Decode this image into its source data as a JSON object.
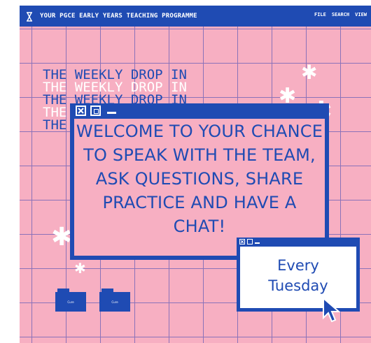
{
  "header": {
    "title": "YOUR PGCE EARLY YEARS TEACHING PROGRAMME",
    "menu": [
      "FILE",
      "SEARCH",
      "VIEW"
    ]
  },
  "echo_title": "THE WEEKLY DROP IN",
  "main_window": {
    "lines": [
      "WELCOME TO YOUR CHANCE",
      "TO SPEAK WITH THE TEAM,",
      "ASK QUESTIONS, SHARE",
      "PRACTICE AND HAVE A",
      "CHAT!"
    ]
  },
  "small_window": {
    "lines": [
      "Every",
      "Tuesday"
    ]
  },
  "folders": [
    {
      "label": "Cure"
    },
    {
      "label": "Cure"
    }
  ],
  "colors": {
    "accent": "#1f4bb3",
    "background": "#f7afc2",
    "grid": "#8b72b9"
  },
  "icons": [
    "hourglass-icon",
    "close-icon",
    "maximize-icon",
    "minimize-icon",
    "sparkle-icon",
    "folder-icon",
    "cursor-icon"
  ]
}
